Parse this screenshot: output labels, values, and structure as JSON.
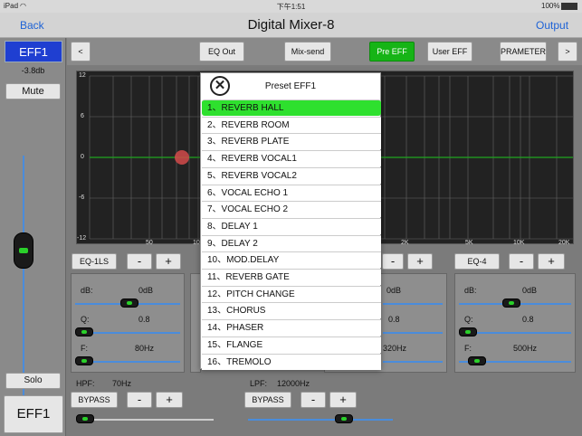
{
  "status": {
    "device": "iPad",
    "wifi_icon": "wifi-icon",
    "time": "下午1:51",
    "battery": "100%"
  },
  "nav": {
    "back": "Back",
    "title": "Digital Mixer-8",
    "output": "Output"
  },
  "left": {
    "channel": "EFF1",
    "level": "-3.8db",
    "mute": "Mute",
    "solo": "Solo",
    "bottom": "EFF1"
  },
  "toolbar": {
    "prev": "<",
    "eq_out": "EQ Out",
    "mix_send": "Mix-send",
    "pre_eff": "Pre EFF",
    "user_eff": "User EFF",
    "parameter": "PRAMETER",
    "next": ">"
  },
  "graph": {
    "y_ticks": [
      "12",
      "6",
      "0",
      "-6",
      "-12"
    ],
    "x_ticks": [
      "50",
      "10",
      "2K",
      "5K",
      "10K",
      "20K"
    ]
  },
  "eq": {
    "eq1": {
      "name": "EQ-1LS",
      "minus": "-",
      "plus": "+",
      "db_label": "dB:",
      "db": "0dB",
      "q_label": "Q:",
      "q": "0.8",
      "f_label": "F:",
      "f": "80Hz"
    },
    "eq3": {
      "minus": "-",
      "plus": "+",
      "db": "0dB",
      "q": "0.8",
      "f": "320Hz"
    },
    "eq4": {
      "name": "EQ-4",
      "minus": "-",
      "plus": "+",
      "db_label": "dB:",
      "db": "0dB",
      "q_label": "Q:",
      "q": "0.8",
      "f_label": "F:",
      "f": "500Hz"
    }
  },
  "filters": {
    "hpf_label": "HPF:",
    "hpf": "70Hz",
    "lpf_label": "LPF:",
    "lpf": "12000Hz",
    "bypass": "BYPASS",
    "minus": "-",
    "plus": "+"
  },
  "dialog": {
    "title": "Preset EFF1",
    "close": "✕",
    "presets": [
      "1、REVERB HALL",
      "2、REVERB ROOM",
      "3、REVERB PLATE",
      "4、REVERB VOCAL1",
      "5、REVERB VOCAL2",
      "6、VOCAL ECHO 1",
      "7、VOCAL ECHO 2",
      "8、DELAY 1",
      "9、DELAY 2",
      "10、MOD.DELAY",
      "11、REVERB GATE",
      "12、PITCH CHANGE",
      "13、CHORUS",
      "14、PHASER",
      "15、FLANGE",
      "16、TREMOLO"
    ]
  },
  "colors": {
    "accent": "#1d62d6",
    "selected": "#2ee02e",
    "eff_blue": "#1f3fd1"
  }
}
